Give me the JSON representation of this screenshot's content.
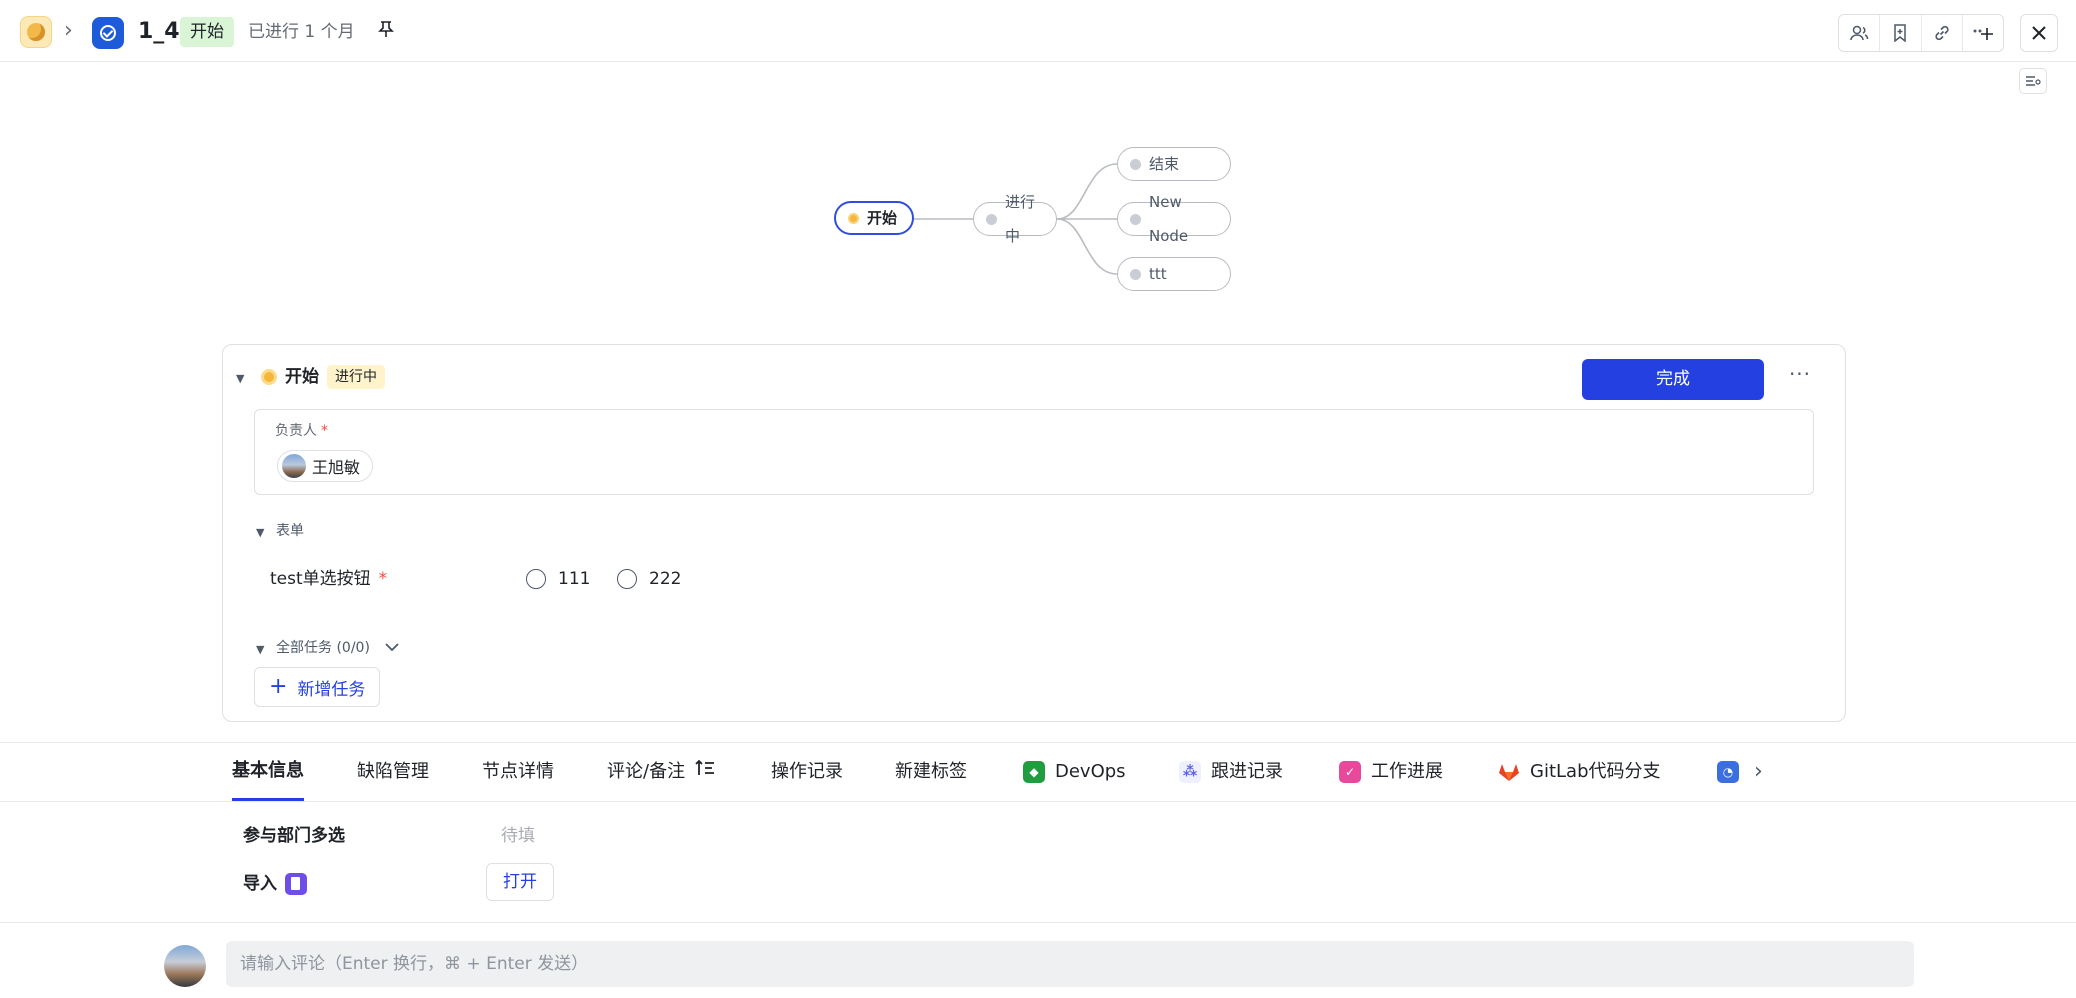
{
  "header": {
    "title": "1_4",
    "status": "开始",
    "progress_text": "已进行 1 个月",
    "pin_icon": "pin-icon",
    "toolbar_icons": [
      "members-icon",
      "bookmark-icon",
      "link-icon",
      "more-add-icon"
    ],
    "close_icon": "close-icon",
    "colors": {
      "status_tag_bg": "#d9f5d6",
      "item_icon_bg": "#1e5bd8"
    }
  },
  "flow": {
    "nodes": [
      {
        "label": "开始",
        "state": "active"
      },
      {
        "label": "进行中",
        "state": "default"
      },
      {
        "label": "结束",
        "state": "default"
      },
      {
        "label": "New Node",
        "state": "default"
      },
      {
        "label": "ttt",
        "state": "default"
      }
    ],
    "colors": {
      "active_border": "#2f4de0",
      "active_dot": "#f5b73b",
      "edge": "#b8bcc2"
    }
  },
  "node_card": {
    "title": "开始",
    "status": "进行中",
    "complete_button": "完成",
    "more_icon": "more-icon",
    "assignee_label": "负责人",
    "required_mark": "*",
    "assignee_name": "王旭敏",
    "form_section": "表单",
    "radio_field_label": "test单选按钮",
    "radio_options": [
      "111",
      "222"
    ],
    "tasks_label": "全部任务 (0/0)",
    "add_task_button": "新增任务",
    "colors": {
      "primary": "#2440e0",
      "required": "#f54a45",
      "status_bg": "#fff3cc"
    }
  },
  "tabs": {
    "items": [
      {
        "label": "基本信息",
        "active": true
      },
      {
        "label": "缺陷管理"
      },
      {
        "label": "节点详情"
      },
      {
        "label": "评论/备注",
        "icon": "sort-icon"
      },
      {
        "label": "操作记录"
      },
      {
        "label": "新建标签"
      },
      {
        "label": "DevOps",
        "icon": "devops-icon"
      },
      {
        "label": "跟进记录",
        "icon": "follow-up-icon"
      },
      {
        "label": "工作进展",
        "icon": "work-progress-icon"
      },
      {
        "label": "GitLab代码分支",
        "icon": "gitlab-icon"
      }
    ],
    "overflow_icon": "app-icon",
    "next_icon": "chevron-right-icon"
  },
  "basic_info": {
    "fields": [
      {
        "label": "参与部门多选",
        "value": "待填"
      },
      {
        "label": "导入",
        "icon": "import-doc-icon",
        "button": "打开"
      }
    ]
  },
  "comment": {
    "placeholder": "请输入评论（Enter 换行，⌘ + Enter 发送）"
  }
}
